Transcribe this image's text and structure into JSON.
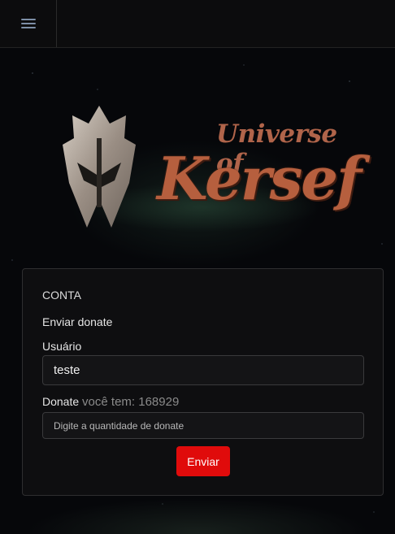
{
  "navbar": {
    "menu_icon": "hamburger-menu-icon"
  },
  "logo": {
    "subtitle": "Universe of",
    "title": "Kersef",
    "helmet_icon": "knight-helmet-icon"
  },
  "card": {
    "title": "CONTA",
    "section_title": "Enviar donate",
    "user_label": "Usuário",
    "user_value": "teste",
    "donate_label": "Donate",
    "balance_text": "você tem: 168929",
    "donate_placeholder": "Digite a quantidade de donate",
    "submit_label": "Enviar"
  },
  "colors": {
    "accent": "#e00b0b",
    "logo": "#b65f3e",
    "background": "#06070a"
  }
}
